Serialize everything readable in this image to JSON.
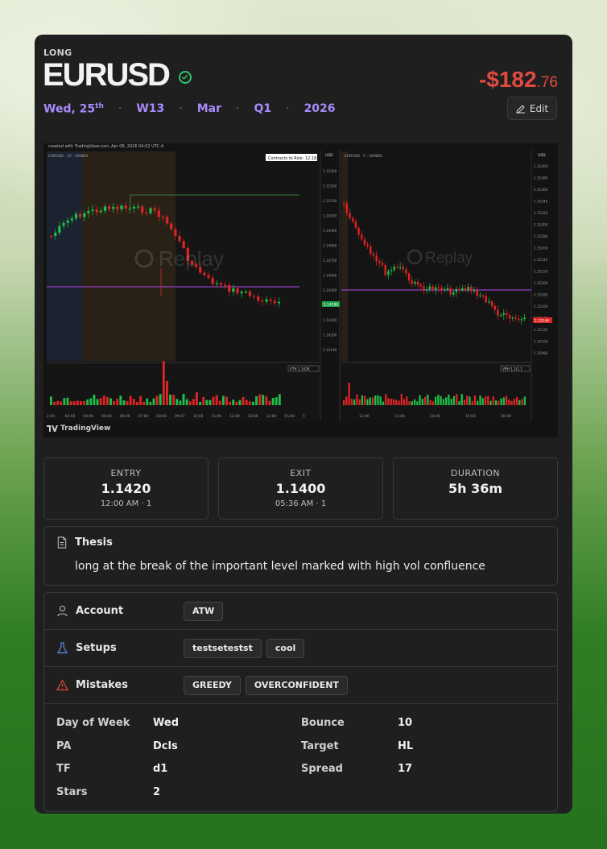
{
  "trade": {
    "side": "LONG",
    "symbol": "EURUSD",
    "pnl_main": "-$182",
    "pnl_cents": ".76",
    "date_day": "Wed, 25",
    "date_sup": "th",
    "week": "W13",
    "month": "Mar",
    "quarter": "Q1",
    "year": "2026",
    "edit_label": "Edit"
  },
  "chart": {
    "left_header": "created with TradingView.com, Apr 08, 2026 04:02 UTC-4",
    "left_symbol": "EURUSD · 15 · OANDA",
    "left_tooltip": "Contracts to Risk: 12.18",
    "right_symbol": "EURUSD · 5 · OANDA",
    "watermark": "Replay",
    "axis_currency": "USD",
    "footer": "TradingView",
    "left_price_labels": [
      "1.15300",
      "1.15200",
      "1.15100",
      "1.15000",
      "1.14900",
      "1.14800",
      "1.14700",
      "1.14600",
      "1.14500",
      "1.14400",
      "1.14300",
      "1.14200",
      "1.14100"
    ],
    "right_price_labels": [
      "1.15400",
      "1.15380",
      "1.15360",
      "1.15340",
      "1.15320",
      "1.15300",
      "1.15280",
      "1.15260",
      "1.15240",
      "1.15220",
      "1.15200",
      "1.15180",
      "1.15160",
      "1.15140",
      "1.15120",
      "1.15100",
      "1.15080"
    ],
    "left_time_labels": [
      "2:00",
      "03:00",
      "04:00",
      "05:00",
      "06:00",
      "07:00",
      "08:00",
      "09:07",
      "10:00",
      "11:00",
      "12:00",
      "13:00",
      "14:00",
      "15:00",
      "5"
    ],
    "right_time_labels": [
      "12:00",
      "13:00",
      "14:00",
      "15:00",
      "16:00"
    ],
    "left_price_badge": "1.14180",
    "right_price_badge": "1.15140",
    "left_vol_label": "VTH  1.142K",
    "right_vol_label": "VRH  1.1/1.1"
  },
  "stats": {
    "entry_label": "ENTRY",
    "entry_value": "1.1420",
    "entry_sub": "12:00 AM · 1",
    "exit_label": "EXIT",
    "exit_value": "1.1400",
    "exit_sub": "05:36 AM · 1",
    "duration_label": "DURATION",
    "duration_value": "5h 36m"
  },
  "thesis": {
    "title": "Thesis",
    "text": "long at the break of the important level marked with high vol confluence"
  },
  "props": {
    "account_label": "Account",
    "account_tags": [
      "ATW"
    ],
    "setups_label": "Setups",
    "setups_tags": [
      "testsetestst",
      "cool"
    ],
    "mistakes_label": "Mistakes",
    "mistakes_tags": [
      "GREEDY",
      "OVERCONFIDENT"
    ],
    "fields": [
      {
        "k": "Day of Week",
        "v": "Wed"
      },
      {
        "k": "PA",
        "v": "Dcls"
      },
      {
        "k": "TF",
        "v": "d1"
      },
      {
        "k": "Stars",
        "v": "2"
      },
      {
        "k": "Bounce",
        "v": "10"
      },
      {
        "k": "Target",
        "v": "HL"
      },
      {
        "k": "Spread",
        "v": "17"
      }
    ]
  },
  "colors": {
    "accent": "#a78bfa",
    "loss": "#e14a3f",
    "bull": "#1fbf4a",
    "bear": "#e02424",
    "level": "#9b3fc8"
  }
}
